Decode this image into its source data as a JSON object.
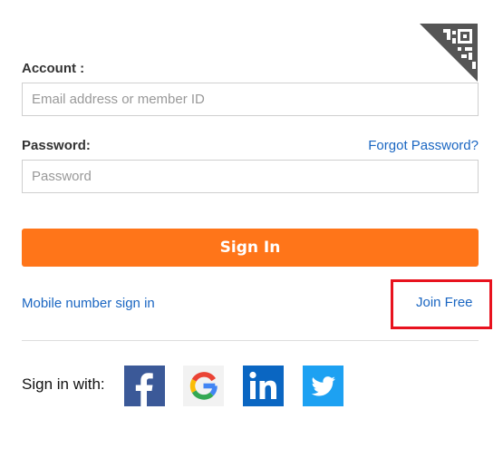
{
  "form": {
    "account_label": "Account :",
    "account_placeholder": "Email address or member ID",
    "password_label": "Password:",
    "password_placeholder": "Password",
    "forgot_password": "Forgot Password?",
    "sign_in_button": "Sign In",
    "mobile_sign_in": "Mobile number sign in",
    "join_free": "Join Free"
  },
  "social": {
    "label": "Sign in with:",
    "providers": [
      {
        "name": "facebook-icon",
        "color": "#3b5998"
      },
      {
        "name": "google-icon",
        "color": "#4285f4"
      },
      {
        "name": "linkedin-icon",
        "color": "#0a66c2"
      },
      {
        "name": "twitter-icon",
        "color": "#1da1f2"
      }
    ]
  },
  "colors": {
    "accent": "#ff7519",
    "link": "#1a66c2",
    "highlight_box": "#e8121e"
  },
  "icons": {
    "qr_corner": "qr-code-icon"
  }
}
